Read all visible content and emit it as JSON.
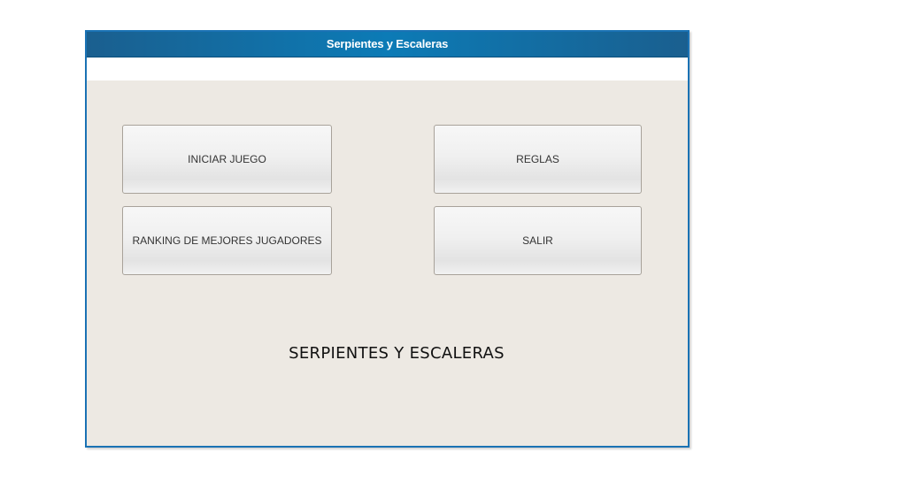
{
  "window": {
    "title": "Serpientes y Escaleras"
  },
  "menu": {
    "start_label": "INICIAR JUEGO",
    "rules_label": "REGLAS",
    "ranking_label": "RANKING DE MEJORES JUGADORES",
    "exit_label": "SALIR"
  },
  "main": {
    "game_title": "SERPIENTES Y ESCALERAS"
  },
  "colors": {
    "titlebar": "#0c7bb6",
    "border": "#1a72b4",
    "background": "#ede9e3"
  }
}
